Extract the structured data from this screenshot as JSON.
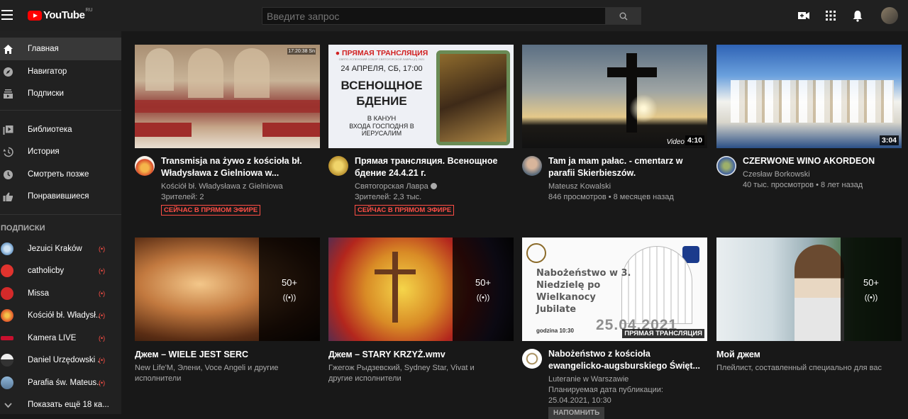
{
  "header": {
    "logo_text": "YouTube",
    "logo_region": "RU",
    "search_placeholder": "Введите запрос"
  },
  "sidebar": {
    "main": [
      {
        "label": "Главная",
        "icon": "home-icon"
      },
      {
        "label": "Навигатор",
        "icon": "compass-icon"
      },
      {
        "label": "Подписки",
        "icon": "subscriptions-icon"
      }
    ],
    "library": [
      {
        "label": "Библиотека",
        "icon": "library-icon"
      },
      {
        "label": "История",
        "icon": "history-icon"
      },
      {
        "label": "Смотреть позже",
        "icon": "clock-icon"
      },
      {
        "label": "Понравившиеся",
        "icon": "thumbs-up-icon"
      }
    ],
    "subscriptions_heading": "ПОДПИСКИ",
    "subscriptions": [
      {
        "label": "Jezuici Kraków",
        "live": "(•)"
      },
      {
        "label": "catholicby",
        "live": "(•)"
      },
      {
        "label": "Missa",
        "live": "(•)"
      },
      {
        "label": "Kościół bł. Władysł...",
        "live": "(•)"
      },
      {
        "label": "Kamera LIVE",
        "live": "(•)"
      },
      {
        "label": "Daniel Urzędowski ...",
        "live": "(•)"
      },
      {
        "label": "Parafia św. Mateus...",
        "live": "(•)"
      }
    ],
    "show_more": "Показать ещё 18 ка..."
  },
  "videos_row1": [
    {
      "title1": "Transmisja na żywo z kościoła bł.",
      "title2": "Władysława z Gielniowa w...",
      "channel": "Kościół bł. Władysława z Gielniowa",
      "meta": "Зрителей: 2",
      "badge": "СЕЙЧАС В ПРЯМОМ ЭФИРЕ",
      "thumb_caption": "17:20:38 Sn"
    },
    {
      "title1": "Прямая трансляция. Всенощное",
      "title2": "бдение 24.4.21 г.",
      "channel": "Святогорская Лавра",
      "meta": "Зрителей: 2,3 тыс.",
      "badge": "СЕЙЧАС В ПРЯМОМ ЭФИРЕ",
      "thumb_live": "● ПРЯМАЯ ТРАНСЛЯЦИЯ",
      "thumb_sub": "СВЯТО-УСПЕНСКИЙ СОБОР СВЯТОГОРСКОЙ ЛАВРЫ (С) 2021",
      "thumb_date": "24 АПРЕЛЯ, СБ, 17:00",
      "thumb_big1": "ВСЕНОЩНОЕ",
      "thumb_big2": "БДЕНИЕ",
      "thumb_small1": "В КАНУН",
      "thumb_small2": "ВХОДА ГОСПОДНЯ В ИЕРУСАЛИМ"
    },
    {
      "title1": "Tam ja mam pałac. - cmentarz w",
      "title2": "parafii Skierbieszów.",
      "channel": "Mateusz Kowalski",
      "meta": "846 просмотров • 8 месяцев назад",
      "duration": "4:10",
      "thumb_caption": "Video"
    },
    {
      "title1": "CZERWONE WINO AKORDEON",
      "title2": "",
      "channel": "Czesław Borkowski",
      "meta": "40 тыс. просмотров • 8 лет назад",
      "duration": "3:04"
    }
  ],
  "videos_row2": [
    {
      "title": "Джем – WIELE JEST SERC",
      "meta1": "New Life'M, Элени, Voce Angeli и другие",
      "meta2": "исполнители",
      "count": "50+"
    },
    {
      "title": "Джем – STARY KRZYŻ.wmv",
      "meta1": "Гжегож Рыдзевский, Sydney Star, Vivat и",
      "meta2": "другие исполнители",
      "count": "50+"
    },
    {
      "title1": "Nabożeństwo z kościoła",
      "title2": "ewangelicko-augsburskiego Święt...",
      "channel": "Luteranie w Warszawie",
      "meta1": "Планируемая дата публикации:",
      "meta2": "25.04.2021, 10:30",
      "remind": "НАПОМНИТЬ",
      "thumb_title1": "Nabożeństwo w 3.",
      "thumb_title2": "Niedzielę po",
      "thumb_title3": "Wielkanocy",
      "thumb_title4": "Jubilate",
      "thumb_time": "godzina 10:30",
      "thumb_date": "25.04.2021",
      "badge": "ПРЯМАЯ ТРАНСЛЯЦИЯ"
    },
    {
      "title": "Мой джем",
      "meta1": "Плейлист, составленный специально для вас",
      "count": "50+"
    }
  ]
}
